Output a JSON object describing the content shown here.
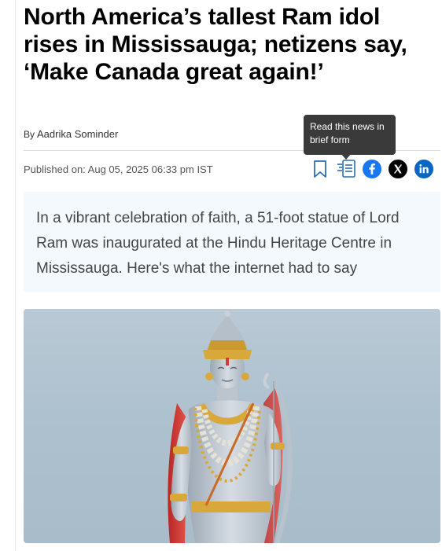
{
  "article": {
    "headline": "North America’s tallest Ram idol rises in Mississauga; netizens say, ‘Make Canada great again!’",
    "byline_prefix": "By",
    "author": "Aadrika Sominder",
    "published": "Published on: Aug 05, 2025 06:33 pm IST",
    "summary": "In a vibrant celebration of faith, a 51-foot statue of Lord Ram was inaugurated at the Hindu Heritage Centre in Mississauga. Here's what the internet had to say"
  },
  "tooltip": {
    "text": "Read this news in brief form"
  },
  "share": {
    "icons": [
      "bookmark-icon",
      "brief-news-icon",
      "facebook-icon",
      "x-icon",
      "linkedin-icon"
    ],
    "colors": {
      "facebook": "#1877f2",
      "x": "#000000",
      "linkedin": "#0a66c2"
    }
  },
  "colors": {
    "summary_bg": "#f3f9fd",
    "sky": "#aec1cf",
    "statue_silver": "#c9d0d8",
    "statue_gold": "#d8a93a",
    "drape_red": "#d63a3a"
  }
}
